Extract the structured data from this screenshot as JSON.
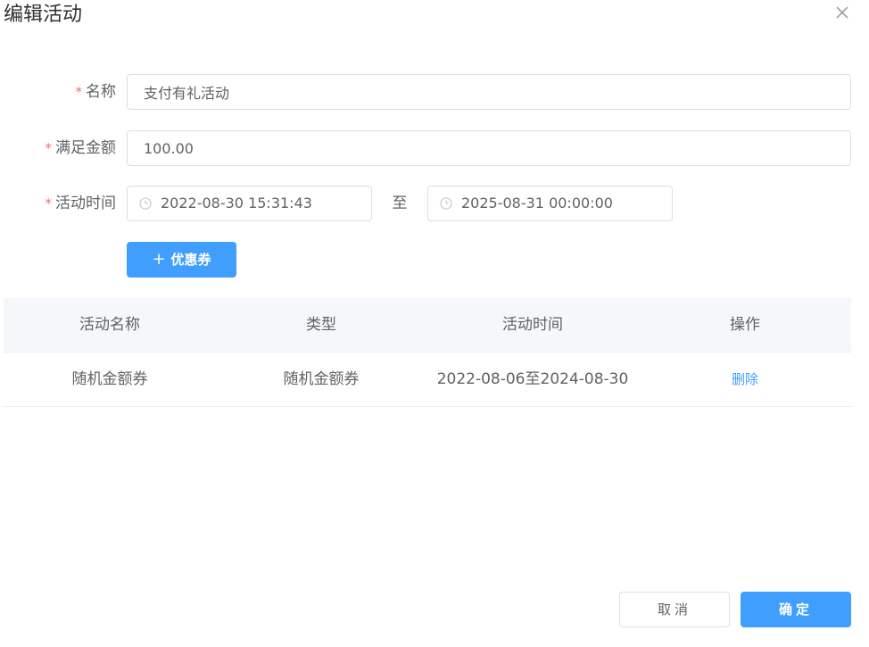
{
  "dialog": {
    "title": "编辑活动"
  },
  "form": {
    "name": {
      "required_mark": "*",
      "label": "名称",
      "value": "支付有礼活动"
    },
    "amount": {
      "required_mark": "*",
      "label": "满足金额",
      "value": "100.00"
    },
    "activity_time": {
      "required_mark": "*",
      "label": "活动时间",
      "start": "2022-08-30 15:31:43",
      "separator": "至",
      "end": "2025-08-31 00:00:00"
    },
    "add_coupon": {
      "icon": "plus-icon",
      "plus": "+",
      "label": "优惠券"
    }
  },
  "table": {
    "headers": [
      "活动名称",
      "类型",
      "活动时间",
      "操作"
    ],
    "rows": [
      {
        "name": "随机金额券",
        "type": "随机金额券",
        "time": "2022-08-06至2024-08-30",
        "action": "删除"
      }
    ]
  },
  "footer": {
    "cancel_label": "取消",
    "confirm_label": "确定"
  },
  "colors": {
    "primary": "#409eff",
    "required": "#f56c6c",
    "text": "#606266",
    "title": "#303133",
    "border": "#dcdfe6",
    "header_bg": "#f5f7fa"
  }
}
